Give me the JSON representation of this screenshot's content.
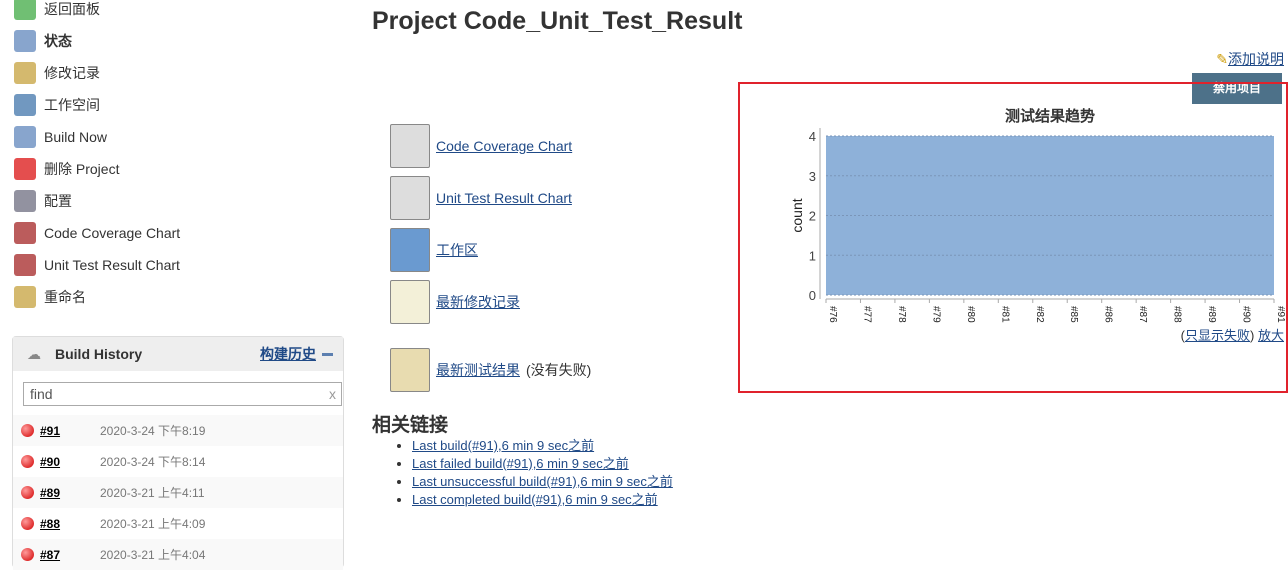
{
  "sidebar": {
    "items": [
      {
        "label": "返回面板",
        "icon": "up-arrow-icon"
      },
      {
        "label": "状态",
        "icon": "search-icon"
      },
      {
        "label": "修改记录",
        "icon": "notepad-icon"
      },
      {
        "label": "工作空间",
        "icon": "folder-icon"
      },
      {
        "label": "Build Now",
        "icon": "clock-icon"
      },
      {
        "label": "删除 Project",
        "icon": "no-icon"
      },
      {
        "label": "配置",
        "icon": "gear-icon"
      },
      {
        "label": "Code Coverage Chart",
        "icon": "chart-icon"
      },
      {
        "label": "Unit Test Result Chart",
        "icon": "chart-icon"
      },
      {
        "label": "重命名",
        "icon": "notepad-icon"
      }
    ]
  },
  "build_history": {
    "title": "Build History",
    "trend_link": "构建历史",
    "search_placeholder": "find",
    "clear": "x",
    "builds": [
      {
        "num": "#91",
        "date": "2020-3-24 下午8:19"
      },
      {
        "num": "#90",
        "date": "2020-3-24 下午8:14"
      },
      {
        "num": "#89",
        "date": "2020-3-21 上午4:11"
      },
      {
        "num": "#88",
        "date": "2020-3-21 上午4:09"
      },
      {
        "num": "#87",
        "date": "2020-3-21 上午4:04"
      }
    ]
  },
  "main": {
    "title": "Project Code_Unit_Test_Result",
    "add_description": "添加说明",
    "disable_button": "禁用项目",
    "links": [
      {
        "label": "Code Coverage Chart"
      },
      {
        "label": "Unit Test Result Chart"
      },
      {
        "label": "工作区"
      },
      {
        "label": "最新修改记录"
      }
    ],
    "latest_test": {
      "label": "最新测试结果",
      "suffix": "(没有失败)"
    },
    "related_title": "相关链接",
    "related": [
      "Last build(#91),6 min 9 sec之前",
      "Last failed build(#91),6 min 9 sec之前",
      "Last unsuccessful build(#91),6 min 9 sec之前",
      "Last completed build(#91),6 min 9 sec之前"
    ],
    "chart_links": {
      "failures_only": "只显示失败",
      "enlarge": "放大"
    }
  },
  "chart_data": {
    "type": "area",
    "title": "测试结果趋势",
    "ylabel": "count",
    "xlabel": "",
    "ylim": [
      0,
      4
    ],
    "yticks": [
      0,
      1,
      2,
      3,
      4
    ],
    "grid": true,
    "categories": [
      "#76",
      "#77",
      "#78",
      "#79",
      "#80",
      "#81",
      "#82",
      "#85",
      "#86",
      "#87",
      "#88",
      "#89",
      "#90",
      "#91"
    ],
    "series": [
      {
        "values": [
          4,
          4,
          4,
          4,
          4,
          4,
          4,
          4,
          4,
          4,
          4,
          4,
          4,
          4
        ],
        "color": "#8eb1d9"
      }
    ]
  }
}
